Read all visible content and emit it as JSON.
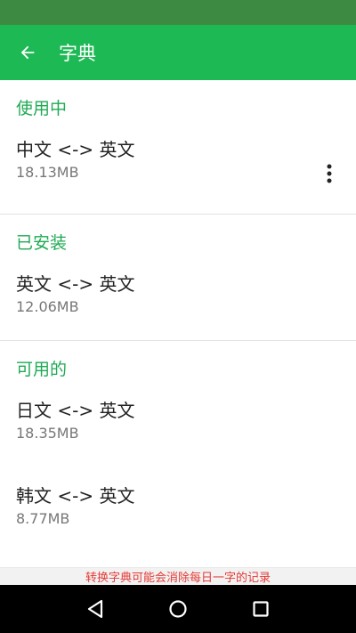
{
  "app_bar": {
    "title": "字典",
    "back_icon": "arrow-left-icon"
  },
  "sections": {
    "in_use": {
      "header": "使用中",
      "items": [
        {
          "title": "中文 <-> 英文",
          "size": "18.13MB"
        }
      ]
    },
    "installed": {
      "header": "已安装",
      "items": [
        {
          "title": "英文 <-> 英文",
          "size": "12.06MB"
        }
      ]
    },
    "available": {
      "header": "可用的",
      "items": [
        {
          "title": "日文 <-> 英文",
          "size": "18.35MB"
        },
        {
          "title": "韩文 <-> 英文",
          "size": "8.77MB"
        }
      ]
    }
  },
  "notice": "转换字典可能会消除每日一字的记录",
  "colors": {
    "status_bar": "#3d8b43",
    "app_bar": "#1db954",
    "section_header": "#1faa54",
    "notice_text": "#e53935"
  },
  "nav": {
    "back_icon": "triangle-back-icon",
    "home_icon": "circle-home-icon",
    "recents_icon": "square-recents-icon"
  }
}
